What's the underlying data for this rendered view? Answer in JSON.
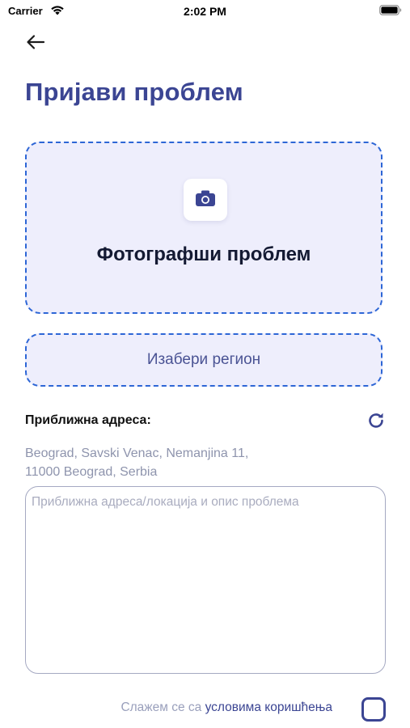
{
  "status_bar": {
    "carrier": "Carrier",
    "time": "2:02 PM"
  },
  "header": {
    "back_icon": "arrow-left-icon",
    "title": "Пријави проблем"
  },
  "photo": {
    "icon": "camera-icon",
    "label": "Фотографши проблем"
  },
  "region": {
    "label": "Изабери регион"
  },
  "address": {
    "label": "Приближна адреса:",
    "refresh_icon": "refresh-icon",
    "line1": "Beograd, Savski Venac, Nemanjina 11,",
    "line2": "11000 Beograd, Serbia"
  },
  "description": {
    "value": "",
    "placeholder": "Приближна адреса/локација и опис проблема"
  },
  "terms": {
    "prefix": "Слажем се са",
    "link": "условима коришћења",
    "checked": false
  },
  "colors": {
    "primary": "#3b4593",
    "dashed_border": "#2d66d6",
    "box_background": "#eeeefc",
    "muted_text": "#8e94ad"
  }
}
